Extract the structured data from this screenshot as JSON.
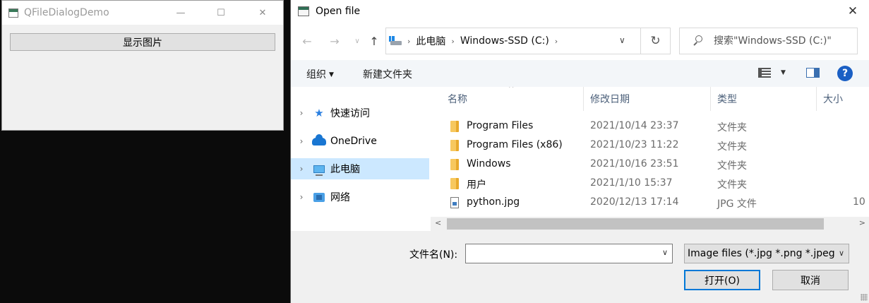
{
  "qt_window": {
    "title": "QFileDialogDemo",
    "minimize_glyph": "—",
    "maximize_glyph": "☐",
    "close_glyph": "✕",
    "show_image_button": "显示图片"
  },
  "dialog": {
    "title": "Open file",
    "close_glyph": "✕",
    "nav": {
      "back_glyph": "←",
      "forward_glyph": "→",
      "recent_glyph": "∨",
      "up_glyph": "↑"
    },
    "breadcrumb": [
      "此电脑",
      "Windows-SSD (C:)"
    ],
    "crumb_sep": "›",
    "address_dropdown_glyph": "∨",
    "refresh_glyph": "↻",
    "search_placeholder": "搜索\"Windows-SSD (C:)\"",
    "toolbar": {
      "organize": "组织",
      "organize_caret": "▼",
      "new_folder": "新建文件夹",
      "view_caret": "▼",
      "help": "?"
    },
    "nav_pane": [
      {
        "label": "快速访问",
        "icon": "star-icon"
      },
      {
        "label": "OneDrive",
        "icon": "cloud-icon"
      },
      {
        "label": "此电脑",
        "icon": "computer-icon",
        "selected": true
      },
      {
        "label": "网络",
        "icon": "network-icon"
      }
    ],
    "nav_chevron": "›",
    "columns": {
      "name": "名称",
      "date": "修改日期",
      "type": "类型",
      "size": "大小",
      "sort_glyph": "^"
    },
    "files": [
      {
        "name": "Program Files",
        "date": "2021/10/14 23:37",
        "type": "文件夹",
        "size": "",
        "icon": "folder-icon"
      },
      {
        "name": "Program Files (x86)",
        "date": "2021/10/23 11:22",
        "type": "文件夹",
        "size": "",
        "icon": "folder-icon"
      },
      {
        "name": "Windows",
        "date": "2021/10/16 23:51",
        "type": "文件夹",
        "size": "",
        "icon": "folder-icon"
      },
      {
        "name": "用户",
        "date": "2021/1/10 15:37",
        "type": "文件夹",
        "size": "",
        "icon": "folder-icon"
      },
      {
        "name": "python.jpg",
        "date": "2020/12/13 17:14",
        "type": "JPG 文件",
        "size": "10",
        "icon": "image-file-icon"
      }
    ],
    "scroll_left_glyph": "<",
    "scroll_right_glyph": ">",
    "filename_label": "文件名(N):",
    "filename_value": "",
    "filename_caret": "∨",
    "filter_value": "Image files (*.jpg *.png *.jpeg)",
    "filter_caret": "∨",
    "open_button": "打开(O)",
    "cancel_button": "取消"
  }
}
